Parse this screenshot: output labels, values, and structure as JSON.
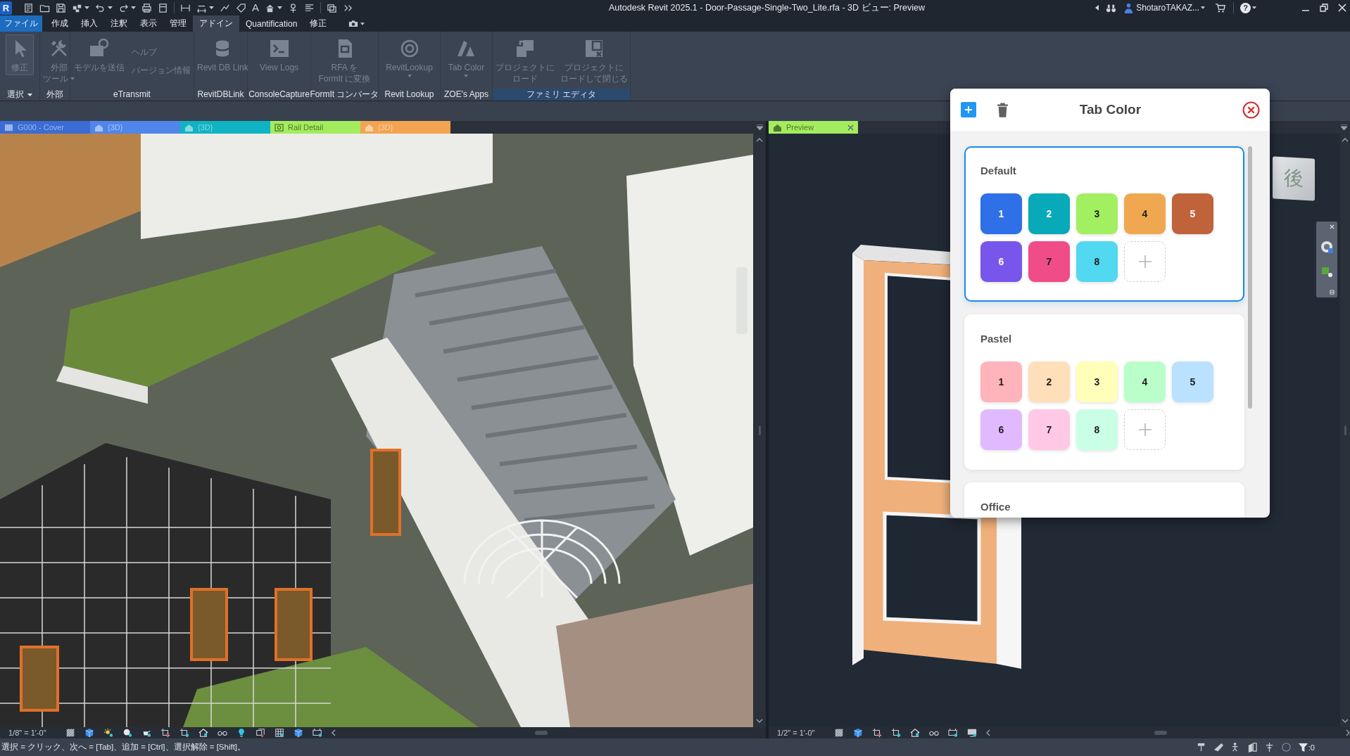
{
  "title_bar": {
    "app_logo": "R",
    "text_tool": "A",
    "title": "Autodesk Revit 2025.1 - Door-Passage-Single-Two_Lite.rfa - 3D ビュー: Preview",
    "user_name": "ShotaroTAKAZ...",
    "help": "?"
  },
  "menu_tabs": [
    {
      "label": "ファイル",
      "kind": "file",
      "selected": false
    },
    {
      "label": "作成",
      "kind": "tab",
      "selected": false
    },
    {
      "label": "挿入",
      "kind": "tab",
      "selected": false
    },
    {
      "label": "注釈",
      "kind": "tab",
      "selected": false
    },
    {
      "label": "表示",
      "kind": "tab",
      "selected": false
    },
    {
      "label": "管理",
      "kind": "tab",
      "selected": false
    },
    {
      "label": "アドイン",
      "kind": "tab",
      "selected": true
    },
    {
      "label": "Quantification",
      "kind": "tab",
      "selected": false
    },
    {
      "label": "修正",
      "kind": "tab",
      "selected": false
    }
  ],
  "ribbon": {
    "panels": [
      {
        "label": "選択",
        "dropdown": true,
        "highlighted": false,
        "buttons": [
          {
            "kind": "pointer",
            "lines": [
              "修正"
            ],
            "dropdown": false,
            "selected": true,
            "disabled": true
          }
        ]
      },
      {
        "label": "外部",
        "dropdown": false,
        "highlighted": false,
        "buttons": [
          {
            "kind": "tools",
            "lines": [
              "外部",
              "ツール"
            ],
            "dropdown": true,
            "selected": false,
            "disabled": true
          }
        ]
      },
      {
        "label": "eTransmit",
        "dropdown": false,
        "highlighted": false,
        "buttons": [
          {
            "kind": "transmit",
            "lines": [
              "モデルを送信"
            ],
            "dropdown": false,
            "selected": false,
            "disabled": true
          },
          {
            "kind": "stack",
            "lines": [
              "ヘルプ",
              "バージョン情報"
            ],
            "dropdown": false,
            "selected": false,
            "disabled": true
          }
        ]
      },
      {
        "label": "RevitDBLink",
        "dropdown": false,
        "highlighted": false,
        "buttons": [
          {
            "kind": "database",
            "lines": [
              "Revit DB Link"
            ],
            "dropdown": false,
            "selected": false,
            "disabled": true
          }
        ]
      },
      {
        "label": "ConsoleCapture",
        "dropdown": false,
        "highlighted": false,
        "buttons": [
          {
            "kind": "terminal",
            "lines": [
              "View Logs"
            ],
            "dropdown": false,
            "selected": false,
            "disabled": true
          }
        ]
      },
      {
        "label": "FormIt コンバータ",
        "dropdown": false,
        "highlighted": false,
        "buttons": [
          {
            "kind": "converter",
            "lines": [
              "RFA を",
              "FormIt に変換"
            ],
            "dropdown": false,
            "selected": false,
            "disabled": true
          }
        ]
      },
      {
        "label": "Revit Lookup",
        "dropdown": false,
        "highlighted": false,
        "buttons": [
          {
            "kind": "lookup",
            "lines": [
              "RevitLookup"
            ],
            "dropdown": true,
            "selected": false,
            "disabled": true
          }
        ]
      },
      {
        "label": "ZOE's Apps",
        "dropdown": false,
        "highlighted": false,
        "buttons": [
          {
            "kind": "palette",
            "lines": [
              "Tab Color"
            ],
            "dropdown": true,
            "selected": false,
            "disabled": true
          }
        ]
      },
      {
        "label": "ファミリ エディタ",
        "dropdown": false,
        "highlighted": true,
        "buttons": [
          {
            "kind": "load",
            "lines": [
              "プロジェクトに",
              "ロード"
            ],
            "dropdown": false,
            "selected": false,
            "disabled": true
          },
          {
            "kind": "loadclose",
            "lines": [
              "プロジェクトに",
              "ロードして閉じる"
            ],
            "dropdown": false,
            "selected": false,
            "disabled": true
          }
        ]
      }
    ]
  },
  "view_tabs": {
    "left": [
      {
        "label": "G000 - Cover",
        "kind": "sheet",
        "color": "#3a6cd3",
        "selected": false
      },
      {
        "label": "{3D}",
        "kind": "model",
        "color": "#4f86ea",
        "selected": false
      },
      {
        "label": "{3D}",
        "kind": "model",
        "color": "#10b3c3",
        "selected": false
      },
      {
        "label": "Rail Detail",
        "kind": "detail",
        "color": "#a3ec5e",
        "selected": false
      },
      {
        "label": "{3D}",
        "kind": "model",
        "color": "#f2a451",
        "selected": false
      }
    ],
    "right": [
      {
        "label": "Preview",
        "kind": "model",
        "color": "#a3ec5e",
        "selected": true
      }
    ]
  },
  "left_view": {
    "scale": "1/8\" = 1'-0\""
  },
  "right_view": {
    "scale": "1/2\" = 1'-0\"",
    "view_cube_face": "後"
  },
  "tab_color_panel": {
    "title": "Tab Color",
    "palettes": [
      {
        "name": "Default",
        "selected": true,
        "swatches": [
          {
            "label": "1",
            "color": "#2f6fe8"
          },
          {
            "label": "2",
            "color": "#08a9b8"
          },
          {
            "label": "3",
            "color": "#a3ef62"
          },
          {
            "label": "4",
            "color": "#f0a850"
          },
          {
            "label": "5",
            "color": "#c0623a"
          },
          {
            "label": "6",
            "color": "#7856ec"
          },
          {
            "label": "7",
            "color": "#f04c88"
          },
          {
            "label": "8",
            "color": "#52d8f0"
          }
        ]
      },
      {
        "name": "Pastel",
        "selected": false,
        "swatches": [
          {
            "label": "1",
            "color": "#ffb3ba"
          },
          {
            "label": "2",
            "color": "#ffdfba"
          },
          {
            "label": "3",
            "color": "#ffffba"
          },
          {
            "label": "4",
            "color": "#baffc9"
          },
          {
            "label": "5",
            "color": "#bae1ff"
          },
          {
            "label": "6",
            "color": "#e0baff"
          },
          {
            "label": "7",
            "color": "#ffc9e6"
          },
          {
            "label": "8",
            "color": "#c9ffe5"
          }
        ]
      },
      {
        "name": "Office",
        "selected": false
      }
    ]
  },
  "status_bar": {
    "hint": "選択 = クリック、次へ = [Tab]、追加 = [Ctrl]、選択解除 = [Shift]。",
    "filter_count": ":0"
  }
}
